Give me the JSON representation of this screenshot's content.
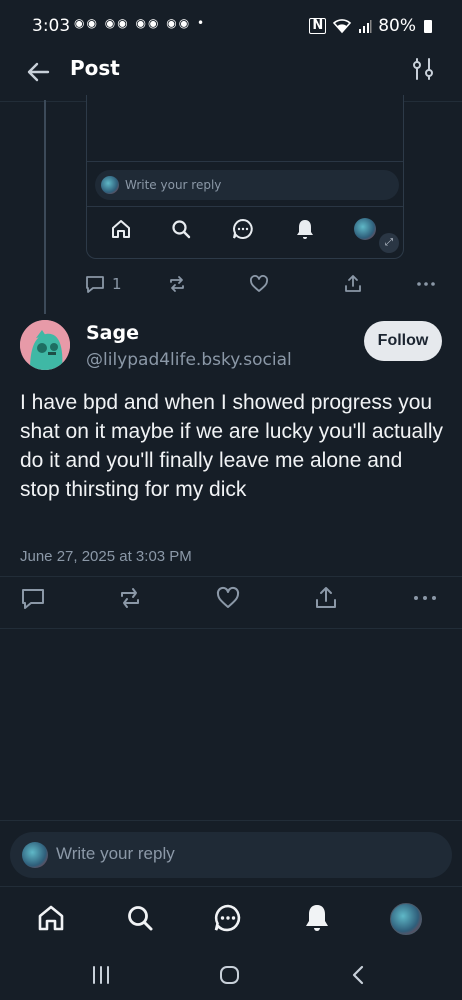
{
  "status_bar": {
    "time": "3:03",
    "notification_icons": "◉◉ ◉◉ ◉◉ ◉◉ •",
    "nfc_label": "N",
    "battery": "80%"
  },
  "header": {
    "title": "Post"
  },
  "embedded_screenshot": {
    "reply_placeholder": "Write your reply"
  },
  "parent_post": {
    "reply_count": "1"
  },
  "post": {
    "author_name": "Sage",
    "author_handle": "@lilypad4life.bsky.social",
    "follow_label": "Follow",
    "text": "I have bpd and when I showed progress you shat on it maybe if we are lucky you'll actually do it and you'll finally leave me alone and stop thirsting for my dick",
    "timestamp": "June 27, 2025 at 3:03 PM"
  },
  "composer": {
    "placeholder": "Write your reply"
  },
  "colors": {
    "background": "#161e27",
    "muted_text": "#8b98a7",
    "divider": "#222d38",
    "follow_button_bg": "#e6e9ed"
  }
}
